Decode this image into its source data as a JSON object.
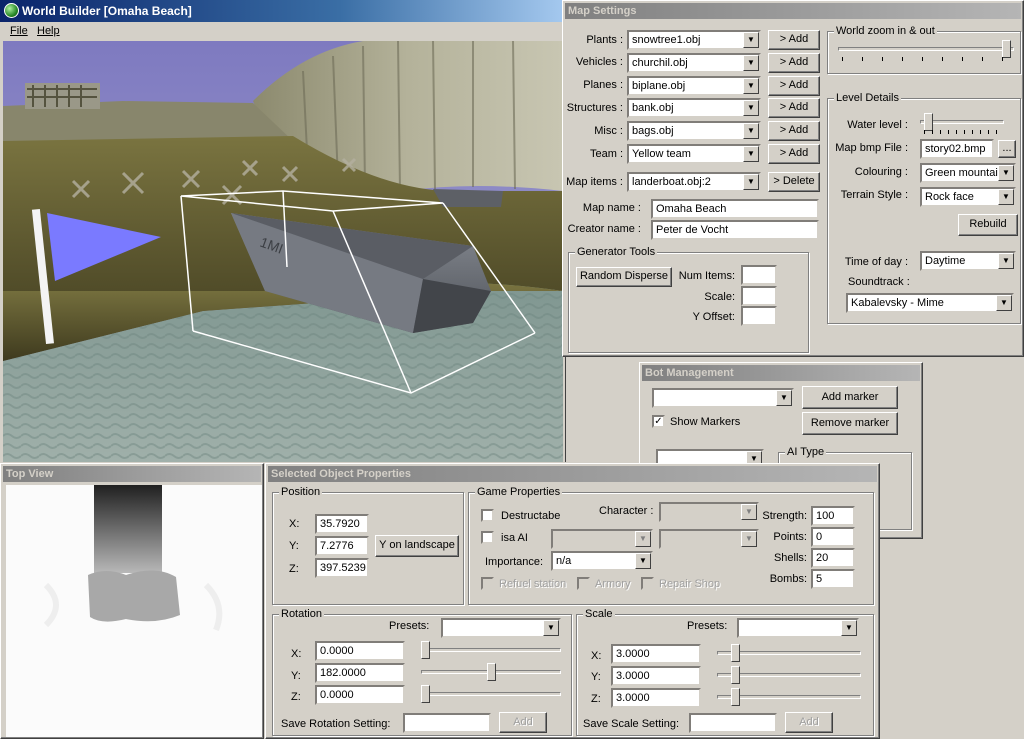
{
  "main_window": {
    "title": "World Builder [Omaha Beach]",
    "menu": [
      "File",
      "Help"
    ]
  },
  "colors": {
    "title_active": "#0a246a",
    "title_inactive": "#808080",
    "flag": "#7a7aff",
    "sky": "#8a86c6"
  },
  "map_settings": {
    "title": "Map Settings",
    "rows": [
      {
        "label": "Plants :",
        "value": "snowtree1.obj",
        "button": "> Add"
      },
      {
        "label": "Vehicles :",
        "value": "churchil.obj",
        "button": "> Add"
      },
      {
        "label": "Planes :",
        "value": "biplane.obj",
        "button": "> Add"
      },
      {
        "label": "Structures :",
        "value": "bank.obj",
        "button": "> Add"
      },
      {
        "label": "Misc :",
        "value": "bags.obj",
        "button": "> Add"
      },
      {
        "label": "Team :",
        "value": "Yellow team",
        "button": "> Add"
      },
      {
        "label": "Map items :",
        "value": "landerboat.obj:2",
        "button": "> Delete"
      }
    ],
    "map_name_label": "Map name :",
    "map_name": "Omaha Beach",
    "creator_label": "Creator name :",
    "creator": "Peter de Vocht",
    "generator": {
      "title": "Generator Tools",
      "random_button": "Random Disperse",
      "num_items": "Num Items:",
      "scale": "Scale:",
      "y_offset": "Y Offset:"
    },
    "zoom": {
      "title": "World zoom in & out",
      "level": 0.98
    },
    "level": {
      "title": "Level Details",
      "water_label": "Water level :",
      "water_level": 0.05,
      "bmp_label": "Map bmp File :",
      "bmp_value": "story02.bmp",
      "browse": "...",
      "colouring_label": "Colouring :",
      "colouring": "Green mountain",
      "terrain_label": "Terrain Style :",
      "terrain": "Rock face",
      "rebuild": "Rebuild",
      "time_label": "Time of day :",
      "time": "Daytime",
      "soundtrack_label": "Soundtrack :",
      "soundtrack": "Kabalevsky - Mime"
    }
  },
  "bot_management": {
    "title": "Bot Management",
    "add_marker": "Add marker",
    "remove_marker": "Remove marker",
    "show_markers": "Show Markers",
    "show_markers_checked": true,
    "ai_type": "AI Type"
  },
  "top_view": {
    "title": "Top View"
  },
  "object_props": {
    "title": "Selected Object Properties",
    "position": {
      "title": "Position",
      "x_label": "X:",
      "x": "35.7920",
      "y_label": "Y:",
      "y": "7.2776",
      "z_label": "Z:",
      "z": "397.5239",
      "landscape_button": "Y on landscape"
    },
    "game": {
      "title": "Game Properties",
      "destructable": "Destructabe",
      "is_ai": "isa AI",
      "character_label": "Character :",
      "importance_label": "Importance:",
      "importance": "n/a",
      "refuel": "Refuel station",
      "armory": "Armory",
      "repair": "Repair Shop",
      "strength_label": "Strength:",
      "strength": "100",
      "points_label": "Points:",
      "points": "0",
      "shells_label": "Shells:",
      "shells": "20",
      "bombs_label": "Bombs:",
      "bombs": "5"
    },
    "rotation": {
      "title": "Rotation",
      "presets": "Presets:",
      "x_label": "X:",
      "x": "0.0000",
      "y_label": "Y:",
      "y": "182.0000",
      "z_label": "Z:",
      "z": "0.0000",
      "save_label": "Save Rotation Setting:",
      "add": "Add",
      "sx": 0.0,
      "sy": 0.5,
      "sz": 0.0
    },
    "scale": {
      "title": "Scale",
      "presets": "Presets:",
      "x_label": "X:",
      "x": "3.0000",
      "y_label": "Y:",
      "y": "3.0000",
      "z_label": "Z:",
      "z": "3.0000",
      "save_label": "Save Scale Setting:",
      "add": "Add",
      "sx": 0.1,
      "sy": 0.1,
      "sz": 0.1
    }
  }
}
